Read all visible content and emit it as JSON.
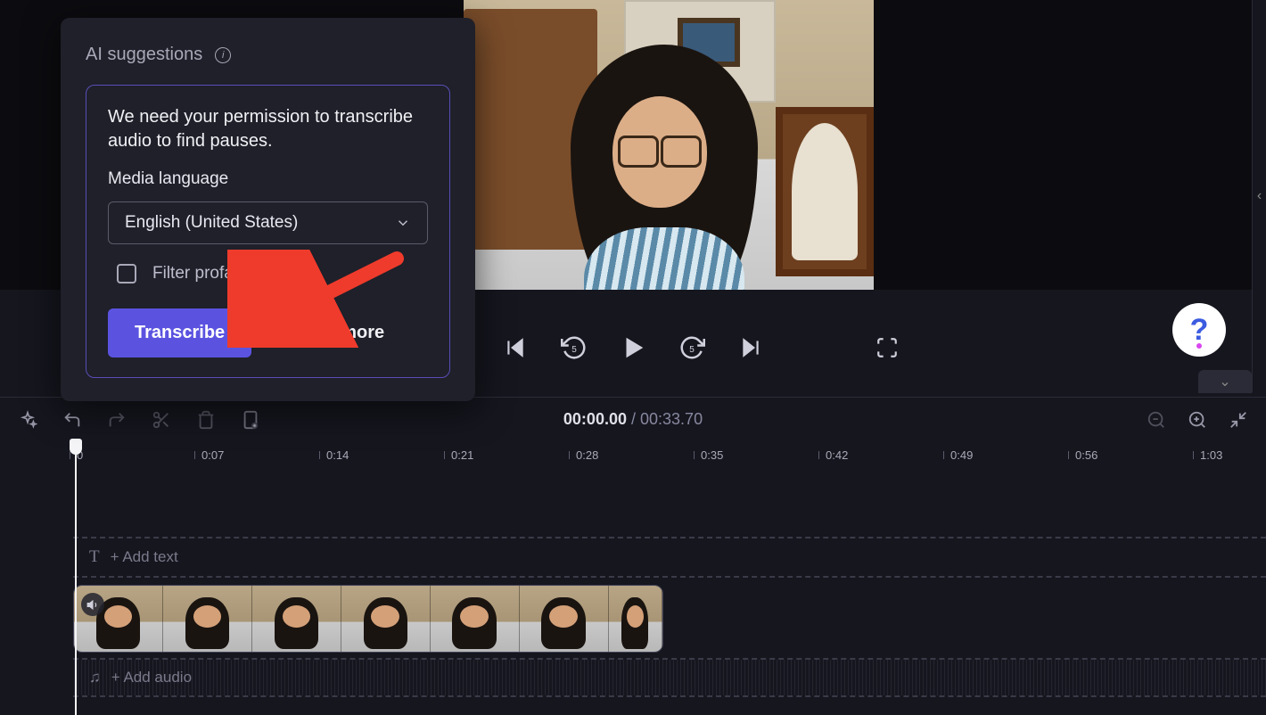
{
  "popup": {
    "title": "AI suggestions",
    "permission_text": "We need your permission to transcribe audio to find pauses.",
    "media_language_label": "Media language",
    "selected_language": "English (United States)",
    "filter_profanity_label": "Filter profanity",
    "transcribe_btn": "Transcribe",
    "learn_more": "Learn more"
  },
  "player": {
    "current_time": "00:00.00",
    "duration": "00:33.70"
  },
  "ruler_ticks": [
    "0",
    "0:07",
    "0:14",
    "0:21",
    "0:28",
    "0:35",
    "0:42",
    "0:49",
    "0:56",
    "1:03"
  ],
  "tracks": {
    "text_placeholder": "+ Add text",
    "audio_placeholder": "+ Add audio"
  },
  "help_glyph": "?",
  "chevrons": {
    "down": "⌄",
    "left": "‹"
  }
}
